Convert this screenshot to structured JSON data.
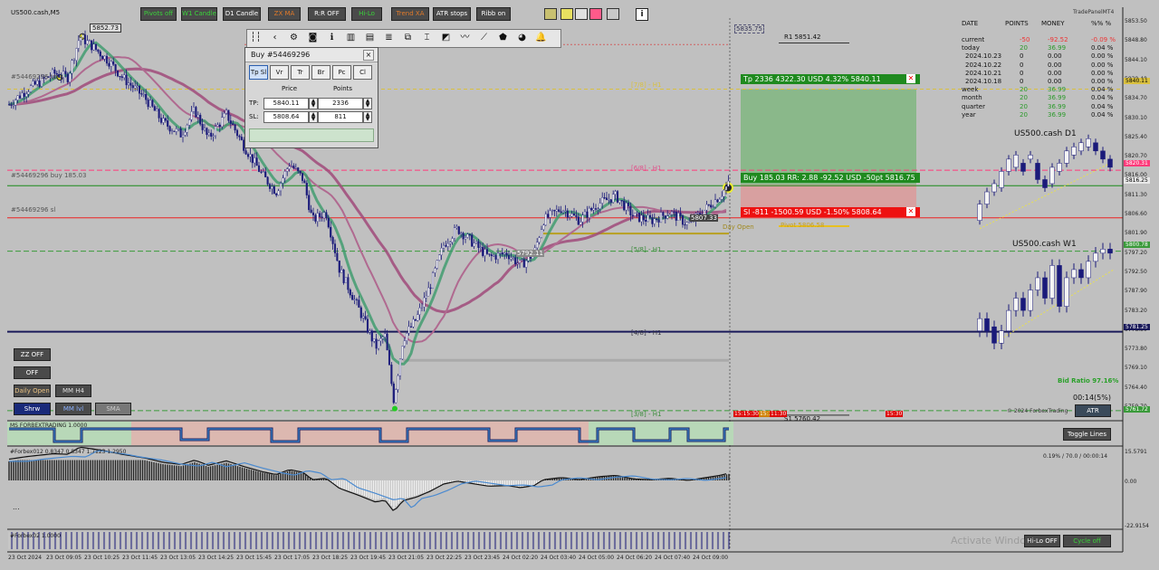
{
  "window": {
    "symbol_title": "US500.cash,M5",
    "price_tag": "5852.73"
  },
  "top_buttons": [
    {
      "label": "Pivots off"
    },
    {
      "label": "W1 Candle"
    },
    {
      "label": "D1 Candle"
    },
    {
      "label": "ZX MA"
    },
    {
      "label": "R:R OFF"
    },
    {
      "label": "Hi-Lo"
    },
    {
      "label": "Trend XA"
    },
    {
      "label": "ATR stops"
    },
    {
      "label": "Ribb on"
    }
  ],
  "color_swatches": [
    "#c8c070",
    "#e8e060",
    "#e0e0e0",
    "#ff5a8a",
    "#c8c8c8"
  ],
  "info_icon": "i",
  "toolbar_icons": [
    "grip-icon",
    "back-arrow-icon",
    "gear-icon",
    "camera-icon",
    "info-icon",
    "bar-chart-icon",
    "table-icon",
    "levels-icon",
    "copy-icon",
    "text-cursor-icon",
    "pen-icon",
    "trend-icon",
    "draw-line-icon",
    "shield-icon",
    "pie-chart-icon",
    "bell-icon"
  ],
  "trade_panel": {
    "title": "Buy #54469296",
    "close_label": "×",
    "tabs": [
      "Tp Sl",
      "Vr",
      "Tr",
      "Br",
      "Pc",
      "Cl"
    ],
    "price_header": "Price",
    "points_header": "Points",
    "tp_label": "TP:",
    "sl_label": "SL:",
    "tp_price": "5840.11",
    "tp_points": "2336",
    "sl_price": "5808.64",
    "sl_points": "811"
  },
  "stats": {
    "brand": "TradePanelMT4",
    "headers": [
      "DATE",
      "POINTS",
      "MONEY",
      "%%  %"
    ],
    "rows": [
      {
        "date": "current",
        "points": "-50",
        "money": "-92.52",
        "pct": "-0.09 %"
      },
      {
        "date": "today",
        "points": "20",
        "money": "36.99",
        "pct": "0.04 %"
      },
      {
        "date": "2024.10.23",
        "points": "0",
        "money": "0.00",
        "pct": "0.00 %"
      },
      {
        "date": "2024.10.22",
        "points": "0",
        "money": "0.00",
        "pct": "0.00 %"
      },
      {
        "date": "2024.10.21",
        "points": "0",
        "money": "0.00",
        "pct": "0.00 %"
      },
      {
        "date": "2024.10.18",
        "points": "0",
        "money": "0.00",
        "pct": "0.00 %"
      },
      {
        "date": "week",
        "points": "20",
        "money": "36.99",
        "pct": "0.04 %"
      },
      {
        "date": "month",
        "points": "20",
        "money": "36.99",
        "pct": "0.04 %"
      },
      {
        "date": "quarter",
        "points": "20",
        "money": "36.99",
        "pct": "0.04 %"
      },
      {
        "date": "year",
        "points": "20",
        "money": "36.99",
        "pct": "0.04 %"
      }
    ]
  },
  "mini_charts": {
    "d1_title": "US500.cash D1",
    "w1_title": "US500.cash W1"
  },
  "trade_bars": {
    "tp": "Tp  2336  4322.30 USD  4.32%  5840.11",
    "entry": "Buy 185.03  RR: 2.88  -92.52 USD  -50pt  5816.75",
    "sl": "Sl  -811   -1500.59 USD  -1.50%  5808.64"
  },
  "chart_labels": {
    "r1": "R1 5851.42",
    "s1": "S1 5760.42",
    "pivot": "Pivot 5806.58",
    "day_open": "Day Open",
    "tp_line": "#54469296 tp",
    "buy_line": "#54469296 buy 185.03",
    "sl_line": "#54469296 sl",
    "m78": "[7/8] - H1",
    "m68": "[6/8] - H1",
    "m58": "[5/8] - H1",
    "m48": "[4/8] - H1",
    "m38": "[3/8] - H1",
    "low_tag": "5792.11",
    "mid_tag": "5807.33",
    "top_tag": "5835.75",
    "bid_ratio": "Bid Ratio 97.16%",
    "timer": "00:14(5%)",
    "copyright": "© 2024 ForbexTrading",
    "time_tags": [
      "15:15:30",
      "15:30",
      "11:30",
      "15:30"
    ]
  },
  "left_buttons": {
    "zz_off": "ZZ OFF",
    "off": "OFF",
    "daily_open": "Daily Open",
    "mm_h4": "MM H4",
    "show": "Shrw",
    "mm_all": "MM lvl",
    "sma": "SMA"
  },
  "atr_button": "ATR",
  "toggle_lines": "Toggle Lines",
  "indicator1": {
    "label": "MS FORBEXTRADING 1.0000"
  },
  "indicator2": {
    "label": "#Forbex012 0.8347 0.8347 1.7123 1.2950",
    "info": "0.19% / 70.0 / 00:00:14",
    "more": "..."
  },
  "indicator3": {
    "label": "#Forbex02 1.0000"
  },
  "bottom_buttons": {
    "hilo_off": "Hi-Lo OFF",
    "cycle": "Cycle off"
  },
  "watermark": "Activate Windows",
  "y_axis": [
    "5853.50",
    "5848.80",
    "5844.10",
    "5839.40",
    "5834.70",
    "5830.10",
    "5825.40",
    "5820.70",
    "5816.00",
    "5811.30",
    "5806.60",
    "5801.90",
    "5797.20",
    "5792.50",
    "5787.90",
    "5783.20",
    "5778.50",
    "5773.80",
    "5769.10",
    "5764.40",
    "5759.70"
  ],
  "y_tags": {
    "tp": "5840.11",
    "cur": "5820.31",
    "entry": "5816.25",
    "w": "5800.78",
    "mid": "5781.25",
    "bot": "5761.72"
  },
  "ind_axis": [
    "15.5791",
    "0.00",
    "-22.9154"
  ],
  "x_axis": [
    "23 Oct 2024",
    "23 Oct 09:05",
    "23 Oct 10:25",
    "23 Oct 11:45",
    "23 Oct 13:05",
    "23 Oct 14:25",
    "23 Oct 15:45",
    "23 Oct 17:05",
    "23 Oct 18:25",
    "23 Oct 19:45",
    "23 Oct 21:05",
    "23 Oct 22:25",
    "23 Oct 23:45",
    "24 Oct 02:20",
    "24 Oct 03:40",
    "24 Oct 05:00",
    "24 Oct 06:20",
    "24 Oct 07:40",
    "24 Oct 09:00"
  ]
}
